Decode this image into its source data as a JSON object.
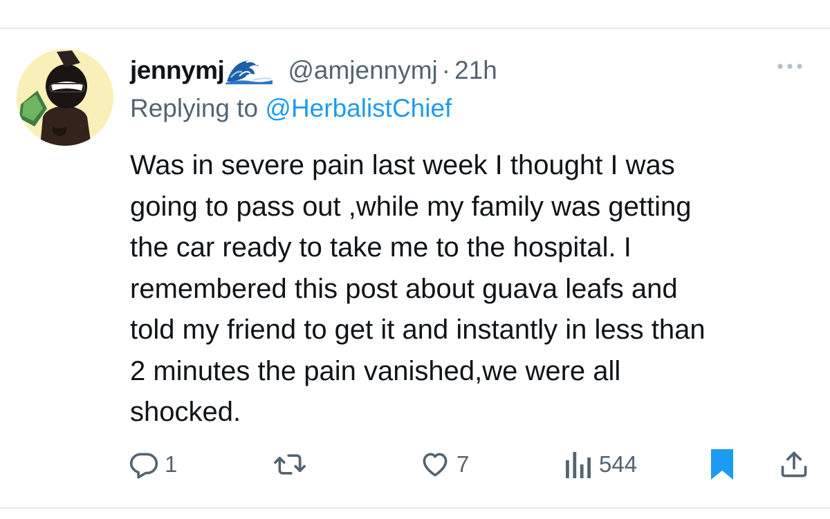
{
  "tweet": {
    "author": {
      "display_name": "jennymj",
      "name_emoji": "wave-emoji",
      "handle": "@amjennymj",
      "separator": "·",
      "time": "21h"
    },
    "reply": {
      "prefix": "Replying to ",
      "target": "@HerbalistChief"
    },
    "text_lines": [
      "Was in severe pain last week I thought I was",
      "going to pass out ,while my family was getting",
      "the car ready to take me to the hospital. I",
      "remembered this post about guava leafs and",
      "told my friend to get it and instantly in less than",
      "2 minutes the pain vanished,we were all",
      "shocked."
    ],
    "actions": {
      "reply_count": "1",
      "repost_count": "",
      "like_count": "7",
      "views_count": "544"
    },
    "icons": [
      "more-icon",
      "reply-icon",
      "repost-icon",
      "like-icon",
      "views-icon",
      "bookmark-icon",
      "share-icon"
    ]
  },
  "colors": {
    "text_primary": "#0f1419",
    "text_secondary": "#536471",
    "link_blue": "#1d9bf0",
    "bookmark_active": "#1d9bf0",
    "avatar_bg": "#f8f0b8"
  }
}
